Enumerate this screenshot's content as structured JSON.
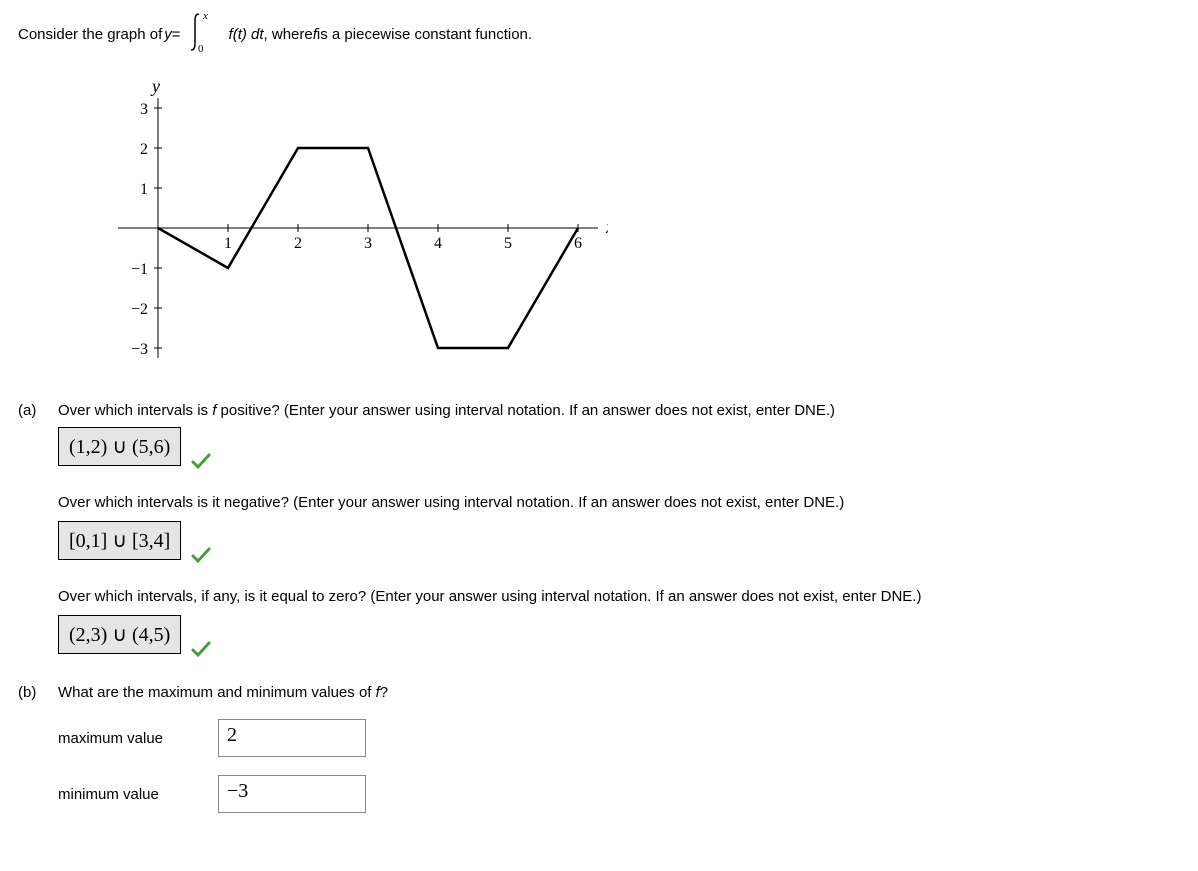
{
  "prompt": {
    "lead": "Consider the graph of ",
    "var": "y",
    "eq": " = ",
    "integrand": "f",
    "of_t_dt": "(t) dt",
    "trail": ", where ",
    "f_ital": "f",
    "trail2": " is a piecewise constant function."
  },
  "graph": {
    "y_label": "y",
    "x_label": "x",
    "y_ticks": [
      "3",
      "2",
      "1",
      "-1",
      "-2",
      "-3"
    ],
    "x_ticks": [
      "1",
      "2",
      "3",
      "4",
      "5",
      "6"
    ]
  },
  "chart_data": {
    "type": "line",
    "title": "",
    "xlabel": "x",
    "ylabel": "y",
    "xlim": [
      0,
      6.3
    ],
    "ylim": [
      -3.3,
      3.3
    ],
    "x": [
      0,
      1,
      2,
      3,
      4,
      5,
      6
    ],
    "y": [
      0,
      -1,
      2,
      2,
      -3,
      -3,
      0
    ]
  },
  "parts": {
    "a": {
      "label": "(a)",
      "q1": "Over which intervals is f positive? (Enter your answer using interval notation. If an answer does not exist, enter DNE.)",
      "a1": "(1,2) ∪ (5,6)",
      "q2": "Over which intervals is it negative? (Enter your answer using interval notation. If an answer does not exist, enter DNE.)",
      "a2": "[0,1] ∪ [3,4]",
      "q3": "Over which intervals, if any, is it equal to zero? (Enter your answer using interval notation. If an answer does not exist, enter DNE.)",
      "a3": "(2,3) ∪ (4,5)"
    },
    "b": {
      "label": "(b)",
      "q": "What are the maximum and minimum values of f?",
      "f_ital": "f",
      "max_label": "maximum value",
      "max_value": "2",
      "min_label": "minimum value",
      "min_value": "−3"
    }
  }
}
